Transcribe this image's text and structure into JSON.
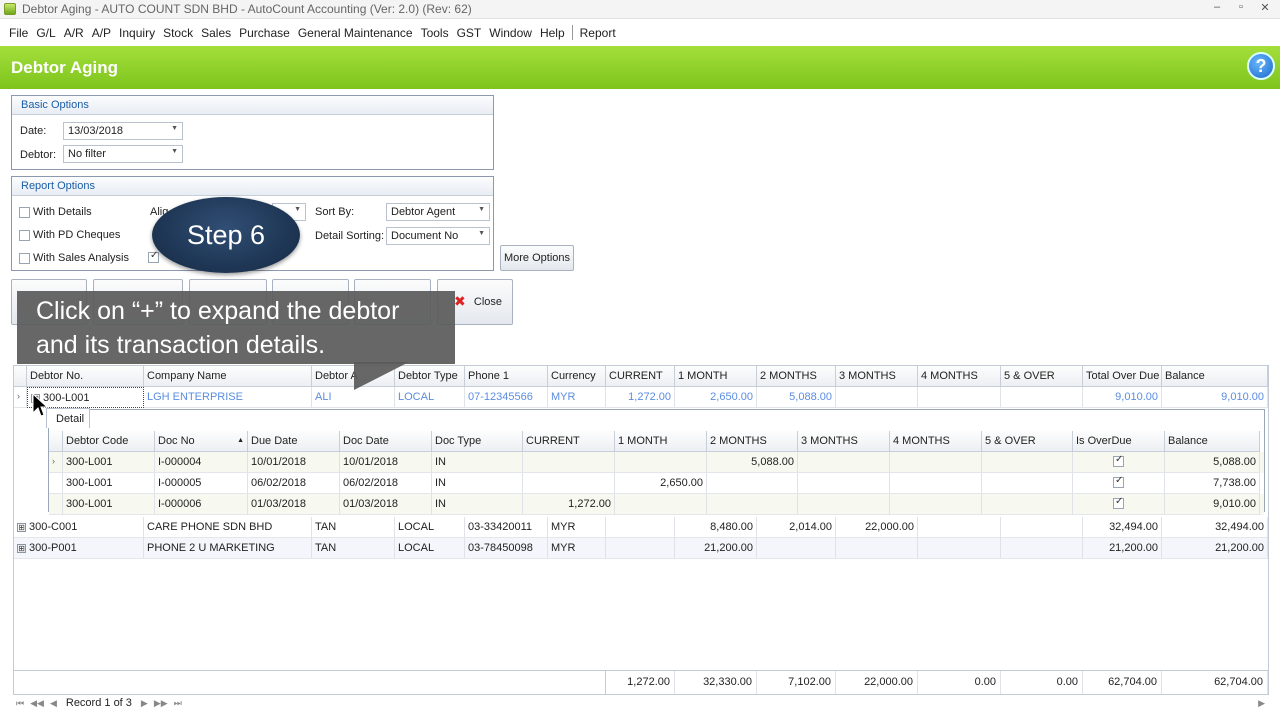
{
  "window": {
    "title": "Debtor Aging - AUTO COUNT SDN BHD - AutoCount Accounting (Ver: 2.0) (Rev: 62)",
    "controls": [
      "–",
      "▫",
      "✕"
    ]
  },
  "menu": [
    "File",
    "G/L",
    "A/R",
    "A/P",
    "Inquiry",
    "Stock",
    "Sales",
    "Purchase",
    "General Maintenance",
    "Tools",
    "GST",
    "Window",
    "Help"
  ],
  "menu_extra": "Report",
  "header": {
    "title": "Debtor Aging",
    "help_label": "?"
  },
  "basic_options": {
    "title": "Basic Options",
    "date_label": "Date:",
    "date_value": "13/03/2018",
    "debtor_label": "Debtor:",
    "debtor_value": "No filter"
  },
  "report_options": {
    "title": "Report Options",
    "with_details": "With Details",
    "with_pd_cheques": "With PD Cheques",
    "with_sales_analysis": "With Sales Analysis",
    "align_label": "Alig",
    "sort_by_label": "Sort By:",
    "sort_by_value": "Debtor Agent",
    "detail_sorting_label": "Detail Sorting:",
    "detail_sorting_value": "Document No",
    "more_options": "More Options"
  },
  "buttons": {
    "close": "Close"
  },
  "overlay": {
    "step": "Step 6",
    "callout_line1": "Click on “+” to expand the debtor",
    "callout_line2": "and its transaction details."
  },
  "grid": {
    "columns": [
      "Debtor No.",
      "Company Name",
      "Debtor A",
      "Debtor Type",
      "Phone 1",
      "Currency",
      "CURRENT",
      "1 MONTH",
      "2 MONTHS",
      "3 MONTHS",
      "4 MONTHS",
      "5 & OVER",
      "Total Over Due",
      "Balance"
    ],
    "rows": [
      {
        "debtor_no": "300-L001",
        "company": "LGH ENTERPRISE",
        "agent": "ALI",
        "type": "LOCAL",
        "phone": "07-12345566",
        "currency": "MYR",
        "current": "1,272.00",
        "m1": "2,650.00",
        "m2": "5,088.00",
        "m3": "",
        "m4": "",
        "m5": "",
        "total_overdue": "9,010.00",
        "balance": "9,010.00",
        "expanded": "⊟"
      },
      {
        "debtor_no": "300-C001",
        "company": "CARE PHONE SDN BHD",
        "agent": "TAN",
        "type": "LOCAL",
        "phone": "03-33420011",
        "currency": "MYR",
        "current": "",
        "m1": "8,480.00",
        "m2": "2,014.00",
        "m3": "22,000.00",
        "m4": "",
        "m5": "",
        "total_overdue": "32,494.00",
        "balance": "32,494.00",
        "expanded": "⊞"
      },
      {
        "debtor_no": "300-P001",
        "company": "PHONE 2 U MARKETING",
        "agent": "TAN",
        "type": "LOCAL",
        "phone": "03-78450098",
        "currency": "MYR",
        "current": "",
        "m1": "21,200.00",
        "m2": "",
        "m3": "",
        "m4": "",
        "m5": "",
        "total_overdue": "21,200.00",
        "balance": "21,200.00",
        "expanded": "⊞"
      }
    ],
    "detail_tab": "Detail",
    "detail_columns": [
      "Debtor Code",
      "Doc No",
      "Due Date",
      "Doc Date",
      "Doc Type",
      "CURRENT",
      "1 MONTH",
      "2 MONTHS",
      "3 MONTHS",
      "4 MONTHS",
      "5 & OVER",
      "Is OverDue",
      "Balance"
    ],
    "detail_rows": [
      {
        "code": "300-L001",
        "doc_no": "I-000004",
        "due": "10/01/2018",
        "doc_date": "10/01/2018",
        "type": "IN",
        "current": "",
        "m1": "",
        "m2": "5,088.00",
        "m3": "",
        "m4": "",
        "m5": "",
        "overdue": true,
        "balance": "5,088.00"
      },
      {
        "code": "300-L001",
        "doc_no": "I-000005",
        "due": "06/02/2018",
        "doc_date": "06/02/2018",
        "type": "IN",
        "current": "",
        "m1": "2,650.00",
        "m2": "",
        "m3": "",
        "m4": "",
        "m5": "",
        "overdue": true,
        "balance": "7,738.00"
      },
      {
        "code": "300-L001",
        "doc_no": "I-000006",
        "due": "01/03/2018",
        "doc_date": "01/03/2018",
        "type": "IN",
        "current": "1,272.00",
        "m1": "",
        "m2": "",
        "m3": "",
        "m4": "",
        "m5": "",
        "overdue": true,
        "balance": "9,010.00"
      }
    ],
    "totals": {
      "current": "1,272.00",
      "m1": "32,330.00",
      "m2": "7,102.00",
      "m3": "22,000.00",
      "m4": "0.00",
      "m5": "0.00",
      "total_overdue": "62,704.00",
      "balance": "62,704.00"
    }
  },
  "navigator": {
    "record": "Record 1 of 3"
  }
}
